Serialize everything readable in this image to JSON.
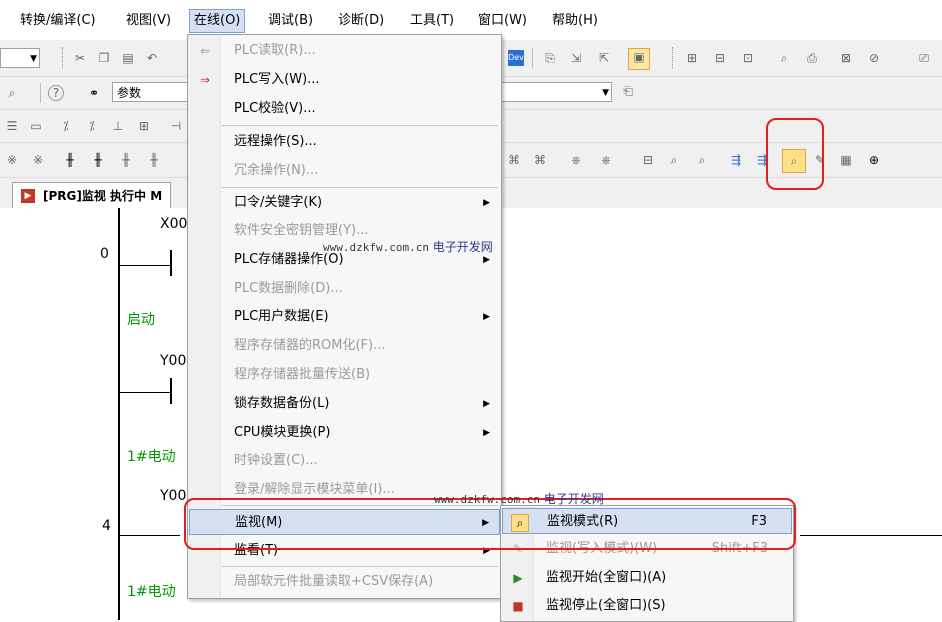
{
  "menubar": {
    "items": [
      "转换/编译(C)",
      "视图(V)",
      "在线(O)",
      "调试(B)",
      "诊断(D)",
      "工具(T)",
      "窗口(W)",
      "帮助(H)"
    ]
  },
  "toolbar": {
    "param_combo": "参数"
  },
  "tab": {
    "label": "[PRG]监视 执行中 M"
  },
  "ladder": {
    "contact1": "X00",
    "step0": "0",
    "comment1": "启动",
    "coil1": "Y00",
    "comment2": "1#电动",
    "contact2": "Y00",
    "step4": "4",
    "comment3": "1#电动"
  },
  "online_menu": {
    "items": [
      {
        "label": "PLC读取(R)...",
        "enabled": false
      },
      {
        "label": "PLC写入(W)...",
        "enabled": true
      },
      {
        "label": "PLC校验(V)...",
        "enabled": true
      },
      {
        "label": "远程操作(S)...",
        "enabled": true
      },
      {
        "label": "冗余操作(N)...",
        "enabled": false
      },
      {
        "label": "口令/关键字(K)",
        "enabled": true
      },
      {
        "label": "软件安全密钥管理(Y)...",
        "enabled": false
      },
      {
        "label": "PLC存储器操作(O)",
        "enabled": true
      },
      {
        "label": "PLC数据删除(D)...",
        "enabled": false
      },
      {
        "label": "PLC用户数据(E)",
        "enabled": true
      },
      {
        "label": "程序存储器的ROM化(F)...",
        "enabled": false
      },
      {
        "label": "程序存储器批量传送(B)",
        "enabled": false
      },
      {
        "label": "锁存数据备份(L)",
        "enabled": true
      },
      {
        "label": "CPU模块更换(P)",
        "enabled": true
      },
      {
        "label": "时钟设置(C)...",
        "enabled": false
      },
      {
        "label": "登录/解除显示模块菜单(I)...",
        "enabled": false
      },
      {
        "label": "监视(M)",
        "enabled": true
      },
      {
        "label": "监看(T)",
        "enabled": true
      },
      {
        "label": "局部软元件批量读取+CSV保存(A)",
        "enabled": false
      }
    ]
  },
  "monitor_submenu": {
    "items": [
      {
        "label": "监视模式(R)",
        "shortcut": "F3",
        "enabled": true
      },
      {
        "label": "监视(写入模式)(W)",
        "shortcut": "Shift+F3",
        "enabled": false
      },
      {
        "label": "监视开始(全窗口)(A)",
        "shortcut": "",
        "enabled": true
      },
      {
        "label": "监视停止(全窗口)(S)",
        "shortcut": "",
        "enabled": true
      }
    ]
  },
  "watermark": {
    "url": "www.dzkfw.com.cn",
    "name": "电子开发网"
  },
  "colors": {
    "highlight": "#d5e1f2",
    "annotation_red": "#e0201c",
    "comment_green": "#009900"
  },
  "icons": [
    "pc-read-icon",
    "pc-write-icon",
    "monitor-mode-icon",
    "monitor-write-icon",
    "monitor-start-icon",
    "monitor-stop-icon",
    "param-search-icon",
    "help-icon",
    "binoculars-icon",
    "program-tab-icon"
  ]
}
